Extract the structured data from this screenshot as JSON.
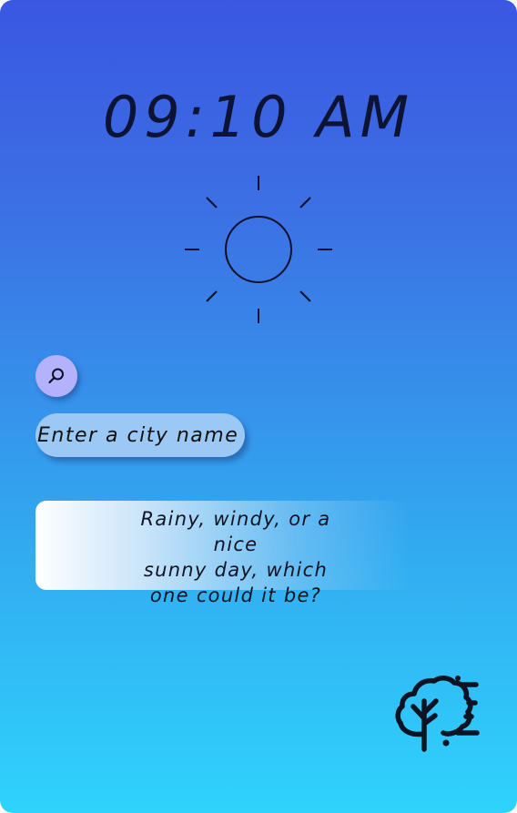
{
  "time": "09:10 AM",
  "weather_icon": "sun-icon",
  "search": {
    "icon": "search-icon",
    "placeholder": "Enter a city name"
  },
  "info": {
    "line1": "Rainy, windy, or a nice",
    "line2": "sunny day, which",
    "line3": "one could it be?"
  },
  "footer_icon": "windy-tree-icon",
  "colors": {
    "gradient_top": "#3a57e2",
    "gradient_bottom": "#2fd3fc",
    "search_button": "#b4b2fc",
    "input_background": "#9cc8f5",
    "ink": "#0a0f2a"
  }
}
